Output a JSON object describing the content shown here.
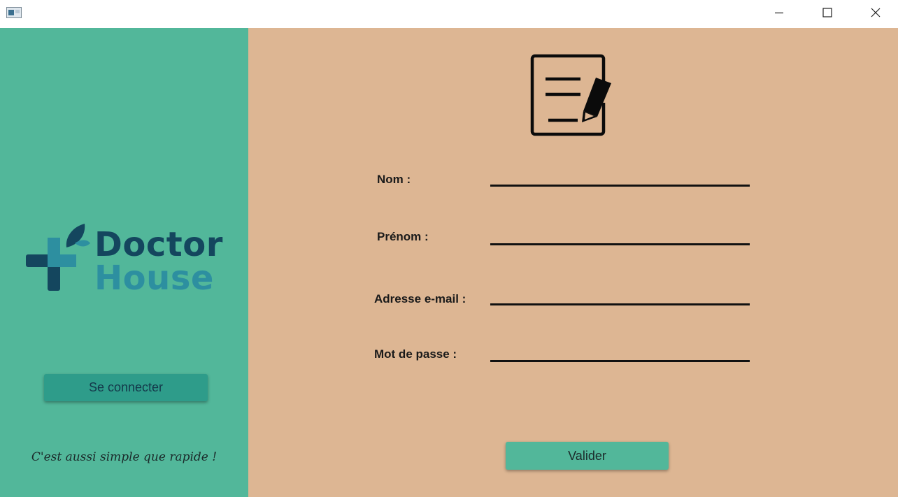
{
  "window": {
    "controls": {
      "minimize_icon": "minimize-icon",
      "maximize_icon": "maximize-icon",
      "close_icon": "close-icon"
    }
  },
  "sidebar": {
    "background_color": "#52b79a",
    "logo": {
      "line1": "Doctor",
      "line2": "House",
      "line1_color": "#14465e",
      "line2_color": "#2d8fa0",
      "icon": "medical-cross-leaf-icon"
    },
    "connect_button_label": "Se connecter",
    "tagline": "C'est aussi simple que rapide !"
  },
  "form": {
    "background_color": "#ddb693",
    "icon": "form-edit-icon",
    "fields": [
      {
        "label": "Nom :",
        "value": "",
        "placeholder": ""
      },
      {
        "label": "Prénom :",
        "value": "",
        "placeholder": ""
      },
      {
        "label": "Adresse e-mail :",
        "value": "",
        "placeholder": ""
      },
      {
        "label": "Mot de passe :",
        "value": "",
        "placeholder": ""
      }
    ],
    "submit_label": "Valider"
  }
}
